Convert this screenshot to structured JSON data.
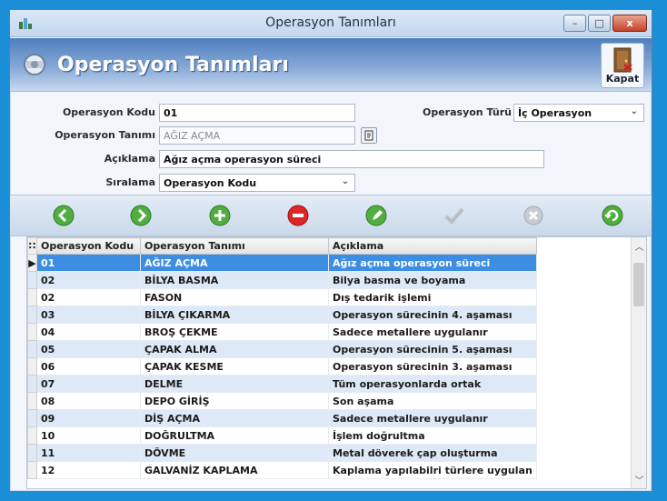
{
  "window": {
    "title": "Operasyon Tanımları",
    "close_label": "x",
    "minimize_label": "–",
    "maximize_label": "□"
  },
  "header": {
    "title": "Operasyon Tanımları",
    "close_button_label": "Kapat"
  },
  "form": {
    "kod_label": "Operasyon Kodu",
    "kod_value": "01",
    "tanim_label": "Operasyon Tanımı",
    "tanim_value": "AĞIZ AÇMA",
    "aciklama_label": "Açıklama",
    "aciklama_value": "Ağız açma operasyon süreci",
    "siralama_label": "Sıralama",
    "siralama_value": "Operasyon Kodu",
    "tur_label": "Operasyon Türü",
    "tur_value": "İç Operasyon"
  },
  "toolbar": [
    "first",
    "next",
    "add",
    "delete",
    "edit",
    "save",
    "cancel",
    "refresh"
  ],
  "grid": {
    "columns": [
      "Operasyon Kodu",
      "Operasyon Tanımı",
      "Açıklama"
    ],
    "rows": [
      [
        "01",
        "AĞIZ AÇMA",
        "Ağız açma operasyon süreci"
      ],
      [
        "02",
        "BİLYA BASMA",
        "Bilya basma ve boyama"
      ],
      [
        "02",
        "FASON",
        "Dış tedarik işlemi"
      ],
      [
        "03",
        "BİLYA ÇIKARMA",
        "Operasyon sürecinin 4. aşaması"
      ],
      [
        "04",
        "BROŞ ÇEKME",
        "Sadece metallere uygulanır"
      ],
      [
        "05",
        "ÇAPAK ALMA",
        "Operasyon sürecinin 5. aşaması"
      ],
      [
        "06",
        "ÇAPAK KESME",
        "Operasyon sürecinin 3. aşaması"
      ],
      [
        "07",
        "DELME",
        "Tüm operasyonlarda ortak"
      ],
      [
        "08",
        "DEPO GİRİŞ",
        "Son aşama"
      ],
      [
        "09",
        "DİŞ AÇMA",
        "Sadece metallere uygulanır"
      ],
      [
        "10",
        "DOĞRULTMA",
        "İşlem doğrultma"
      ],
      [
        "11",
        "DÖVME",
        "Metal döverek çap oluşturma"
      ],
      [
        "12",
        "GALVANİZ KAPLAMA",
        "Kaplama yapılabilri türlere uygulan"
      ]
    ],
    "selected_index": 0
  },
  "colors": {
    "accent": "#3d8ee3",
    "background": "#1a8fd8",
    "alt_row": "#dde9f7"
  }
}
